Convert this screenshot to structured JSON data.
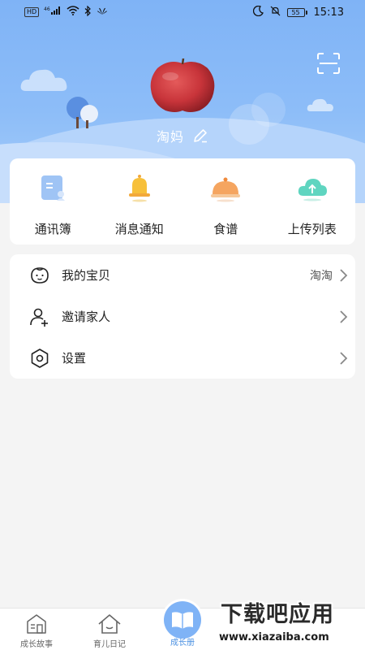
{
  "status_bar": {
    "hd_label": "HD",
    "signal_label": "46",
    "time": "15:13",
    "battery": "55"
  },
  "profile": {
    "username": "淘妈",
    "avatar_icon": "apple-avatar",
    "edit_icon": "pencil-icon",
    "scan_icon": "scan-icon"
  },
  "quick_actions": [
    {
      "label": "通讯簿",
      "icon": "contacts-book-icon"
    },
    {
      "label": "消息通知",
      "icon": "bell-icon"
    },
    {
      "label": "食谱",
      "icon": "food-cover-icon"
    },
    {
      "label": "上传列表",
      "icon": "cloud-upload-icon"
    }
  ],
  "menu": {
    "items": [
      {
        "label": "我的宝贝",
        "value": "淘淘",
        "icon": "baby-face-icon"
      },
      {
        "label": "邀请家人",
        "value": "",
        "icon": "add-user-icon"
      },
      {
        "label": "设置",
        "value": "",
        "icon": "settings-hexagon-icon"
      }
    ]
  },
  "bottom_nav": {
    "items": [
      {
        "label": "成长故事",
        "icon": "story-house-icon"
      },
      {
        "label": "育儿日记",
        "icon": "home-icon"
      },
      {
        "label": "成长册",
        "icon": "book-icon",
        "active": true
      }
    ]
  },
  "watermark": {
    "main": "下载吧应用",
    "url": "www.xiazaiba.com"
  },
  "colors": {
    "header_blue": "#7fb3f6",
    "accent_blue": "#4a90e2",
    "bell_yellow": "#f7c03a",
    "food_orange": "#f5a560",
    "cloud_teal": "#5fd5c0"
  }
}
